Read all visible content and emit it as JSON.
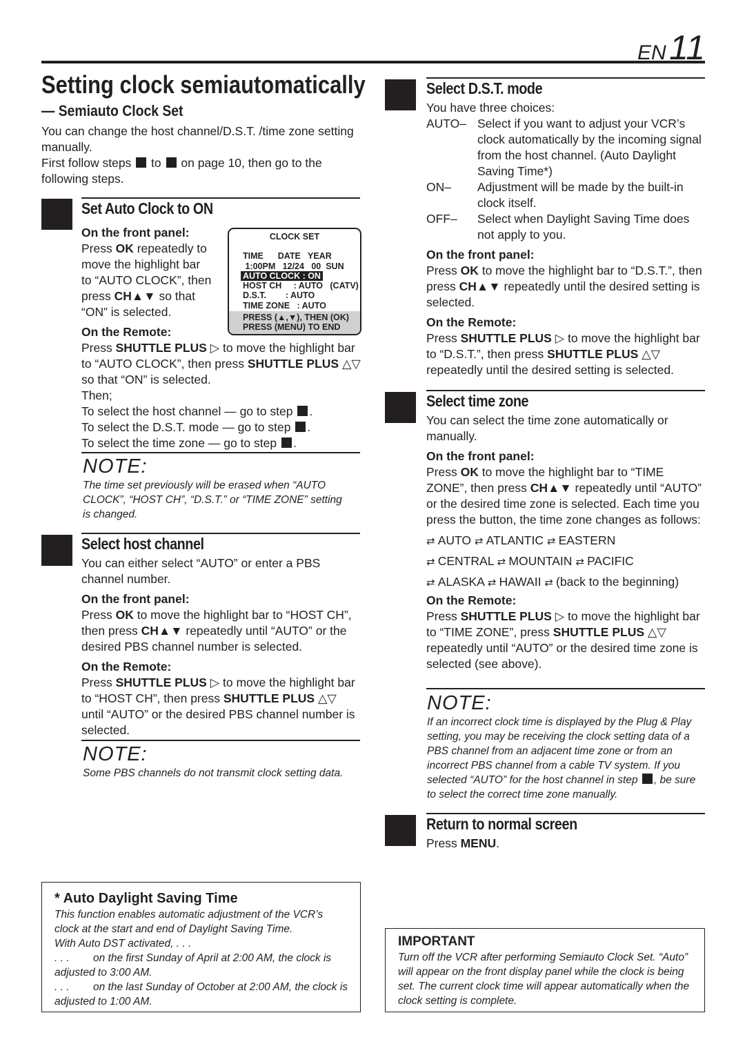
{
  "header": {
    "lang": "EN",
    "page": "11"
  },
  "title": "Setting clock semiautomatically",
  "subtitle": "— Semiauto Clock Set",
  "intro": [
    [
      "You can change the host channel/D.S.T. /time zone setting manually."
    ],
    [
      "First follow steps ",
      {
        "sq": 1
      },
      " to ",
      {
        "sq": 1
      },
      " on page 10, then go to the following steps."
    ]
  ],
  "step1": {
    "heading": "Set Auto Clock to ON",
    "front_label": "On the front panel:",
    "front_text": [
      "Press ",
      {
        "b": "OK"
      },
      " repeatedly to move the highlight bar to “AUTO CLOCK”, then press ",
      {
        "b": "CH▲▼"
      },
      " so that “ON” is selected."
    ],
    "remote_label": "On the Remote:",
    "remote_text": [
      "Press ",
      {
        "b": "SHUTTLE PLUS"
      },
      " ▷ to move the highlight bar to “AUTO CLOCK”, then press ",
      {
        "b": "SHUTTLE PLUS"
      },
      " △▽ so that “ON” is selected."
    ],
    "then": "Then;",
    "goto": [
      [
        "To select the host channel — go to step ",
        {
          "sq": 1
        },
        "."
      ],
      [
        "To select the D.S.T. mode — go to step ",
        {
          "sq": 1
        },
        "."
      ],
      [
        "To select the time zone — go to step ",
        {
          "sq": 1
        },
        "."
      ]
    ],
    "note_heading": "NOTE:",
    "note_text": "The time set previously will be erased when “AUTO CLOCK”, “HOST CH”, “D.S.T.” or “TIME ZONE” setting is changed."
  },
  "clock_display": {
    "title": "CLOCK SET",
    "header_row": "TIME      DATE   YEAR",
    "value_row": " 1:00PM   12/24   00  SUN",
    "highlight": "AUTO CLOCK : ON",
    "host": "HOST CH     : AUTO   (CATV)",
    "dst": "D.S.T.        : AUTO",
    "tz": "TIME ZONE   : AUTO",
    "press1": "PRESS (▲,▼), THEN (OK)",
    "press2": "PRESS (MENU) TO END"
  },
  "step2": {
    "heading": "Select host channel",
    "intro": "You can either select “AUTO” or enter a PBS channel number.",
    "front_label": "On the front panel:",
    "front_text": [
      "Press ",
      {
        "b": "OK"
      },
      " to move the highlight bar to “HOST CH”, then press ",
      {
        "b": "CH▲▼"
      },
      " repeatedly until “AUTO” or the desired PBS channel number is selected."
    ],
    "remote_label": "On the Remote:",
    "remote_text": [
      "Press ",
      {
        "b": "SHUTTLE PLUS"
      },
      " ▷ to move the highlight bar to “HOST CH”, then press ",
      {
        "b": "SHUTTLE PLUS"
      },
      " △▽ until “AUTO” or the desired PBS channel number is selected."
    ],
    "note_heading": "NOTE:",
    "note_text": "Some PBS channels do not transmit clock setting data."
  },
  "dst_box": {
    "heading": "* Auto Daylight Saving Time",
    "lines": [
      "This function enables automatic adjustment of the VCR’s clock at the start and end of Daylight Saving Time.",
      "With Auto DST activated, . . .",
      ". . .        on the first Sunday of April at 2:00 AM, the clock is adjusted to 3:00 AM.",
      ". . .        on the last Sunday of October at 2:00 AM, the clock is adjusted to 1:00 AM."
    ]
  },
  "step3": {
    "heading": "Select D.S.T. mode",
    "intro": "You have three choices:",
    "choices": [
      {
        "key": "AUTO–",
        "text": "Select if you want to adjust your VCR’s clock automatically by the incoming signal from the host channel. (Auto Daylight Saving Time*)"
      },
      {
        "key": "ON–",
        "text": "Adjustment will be made by the built-in clock itself."
      },
      {
        "key": "OFF–",
        "text": "Select when Daylight Saving Time does not apply to you."
      }
    ],
    "front_label": "On the front panel:",
    "front_text": [
      "Press ",
      {
        "b": "OK"
      },
      " to move the highlight bar to “D.S.T.”, then press ",
      {
        "b": "CH▲▼"
      },
      " repeatedly until the desired setting is selected."
    ],
    "remote_label": "On the Remote:",
    "remote_text": [
      "Press ",
      {
        "b": "SHUTTLE PLUS"
      },
      " ▷ to move the highlight bar to “D.S.T.”, then press ",
      {
        "b": "SHUTTLE PLUS"
      },
      " △▽ repeatedly until the desired setting is selected."
    ]
  },
  "step4": {
    "heading": "Select time zone",
    "intro": "You can select the time zone automatically or manually.",
    "front_label": "On the front panel:",
    "front_text": [
      "Press ",
      {
        "b": "OK"
      },
      " to move the highlight bar to “TIME ZONE”, then press ",
      {
        "b": "CH▲▼"
      },
      " repeatedly until “AUTO” or the desired time zone is selected. Each time you press the button, the time zone changes as follows:"
    ],
    "zones": [
      [
        "AUTO",
        "ATLANTIC",
        "EASTERN"
      ],
      [
        "CENTRAL",
        "MOUNTAIN",
        "PACIFIC"
      ],
      [
        "ALASKA",
        "HAWAII",
        "(back to the beginning)"
      ]
    ],
    "remote_label": "On the Remote:",
    "remote_text": [
      "Press ",
      {
        "b": "SHUTTLE PLUS"
      },
      " ▷ to move the highlight bar to “TIME ZONE”, press ",
      {
        "b": "SHUTTLE PLUS"
      },
      " △▽ repeatedly until “AUTO” or the desired time zone is selected (see above)."
    ],
    "note_heading": "NOTE:",
    "note_text": [
      "If an incorrect clock time is displayed by the Plug & Play setting, you may be receiving the clock setting data of a PBS channel from an adjacent time zone or from an incorrect PBS channel from a cable TV system. If you selected “AUTO” for the host channel in step ",
      {
        "sq": 1
      },
      ", be sure to select the correct time zone manually."
    ]
  },
  "step5": {
    "heading": "Return to normal screen",
    "text": [
      "Press ",
      {
        "b": "MENU"
      },
      "."
    ]
  },
  "important": {
    "heading": "IMPORTANT",
    "text": "Turn off the VCR after performing Semiauto Clock Set. “Auto” will appear on the front display panel while the clock is being set. The current clock time will appear automatically when the clock setting is complete."
  },
  "icons": {
    "cycle": "cycle-arrows-icon",
    "step": "step-number-square"
  }
}
